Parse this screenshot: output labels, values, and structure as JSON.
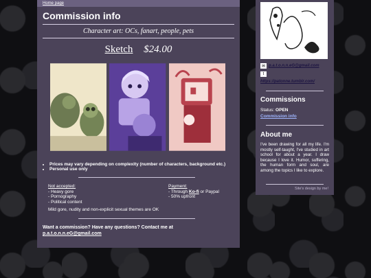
{
  "breadcrumb": {
    "home": "Home page"
  },
  "page": {
    "title": "Commission info",
    "subtitle": "Character art: OCs, fanart, people, pets",
    "tier": "Sketch",
    "price": "$24.00"
  },
  "bullets": [
    "Prices may vary depending on complexity (number of characters, background etc.)",
    "Personal use only"
  ],
  "not_accepted": {
    "heading": "Not accepted:",
    "items": [
      "- Heavy gore",
      "- Pornography",
      "- Political content"
    ]
  },
  "payment": {
    "heading": "Payment:",
    "line1_prefix": "- Through ",
    "line1_brand": "Ko-fi",
    "line1_suffix": " or Paypal",
    "line2": "- 50% upfront"
  },
  "note": "Mild gore, nudity and non-explicit sexual themes are OK",
  "contact": {
    "prompt": "Want a commission? Have any questions? Contact me at",
    "email": "p.a.t.o.n.n.eG@gmail.com"
  },
  "sidebar": {
    "email": "p.a.t.o.n.n.eG@gmail.com",
    "tumblr": "https://patonne.tumblr.com/",
    "commissions_heading": "Commissions",
    "status_label": "Status: ",
    "status_value": "OPEN",
    "commission_link": "Commission info",
    "about_heading": "About me",
    "about_text": "I've been drawing for all my life. I'm mostly self-taught, I've studied in art school for about a year. I draw because I love it. Humor, suffering, the human form and soul, are among the topics I like to explore.",
    "credit": "Site's design by me!"
  },
  "icons": {
    "email": "envelope-icon",
    "tumblr": "tumblr-icon"
  },
  "colors": {
    "panel": "#4b4359",
    "accent_link": "#9fb6ff",
    "background": "#0f0f12"
  }
}
